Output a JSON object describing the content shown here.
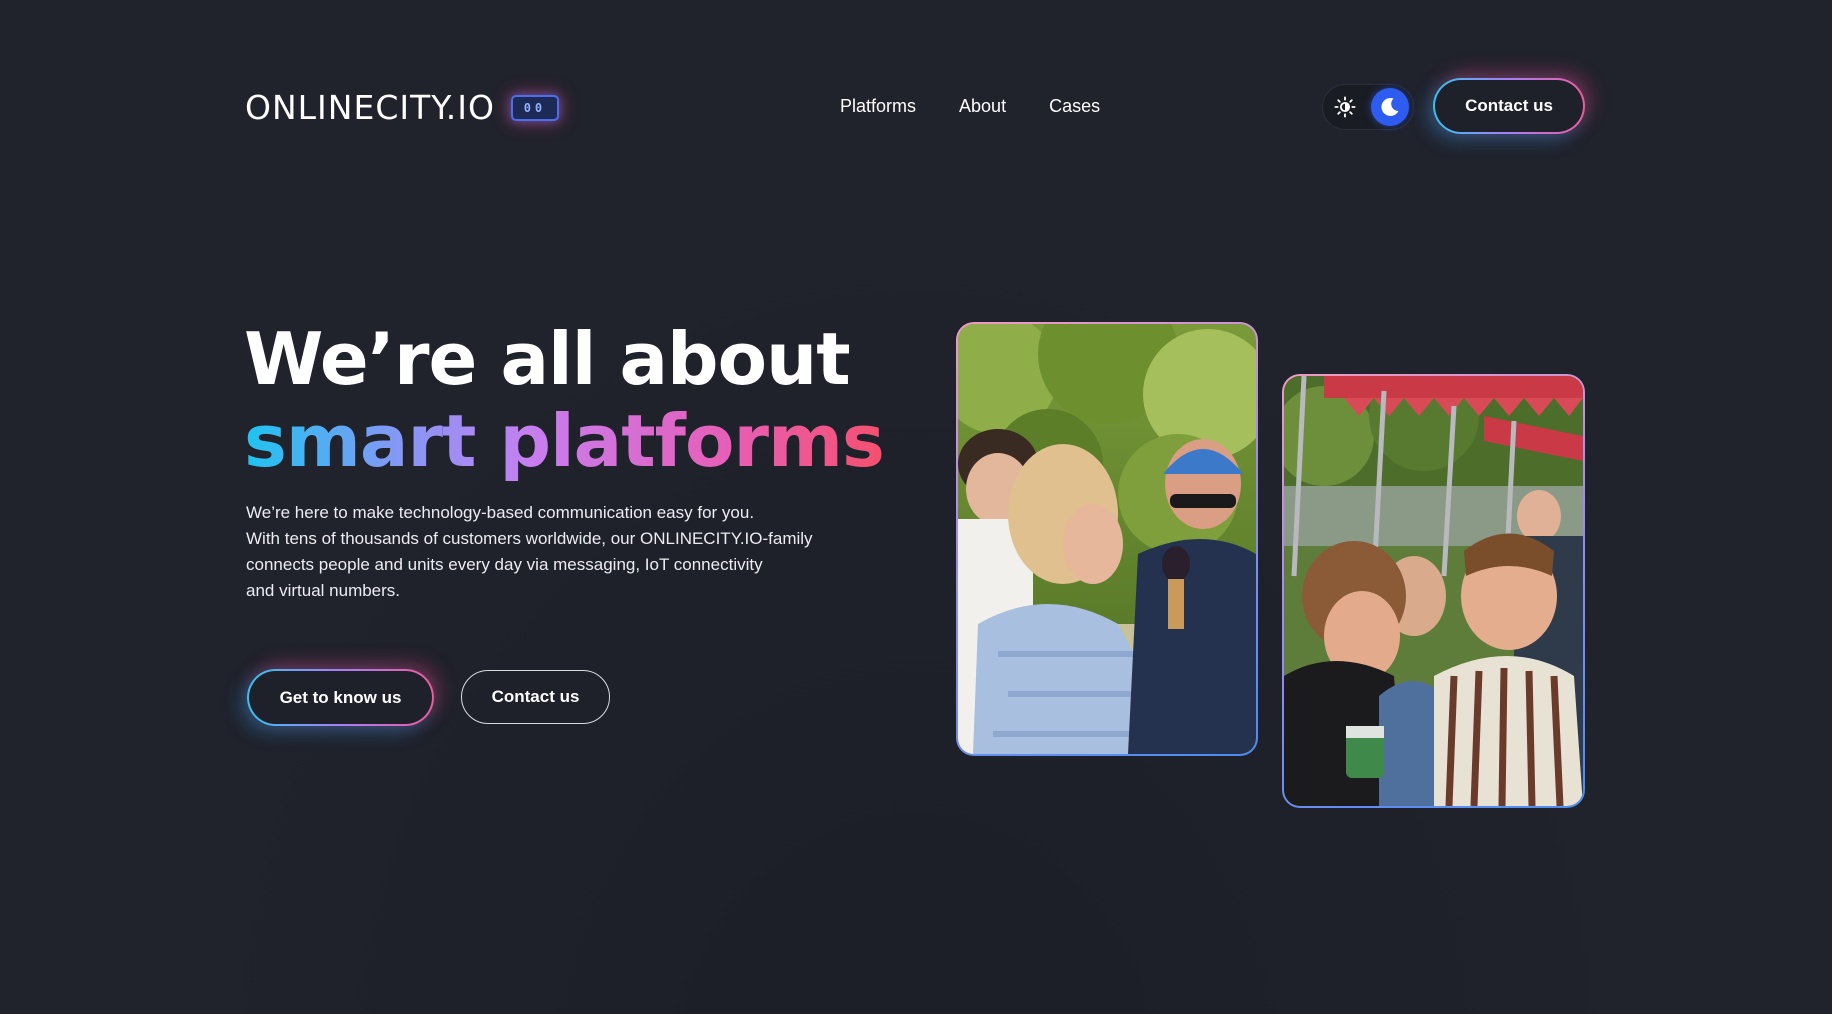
{
  "header": {
    "logo_text": "ONLINECITY.IO",
    "logo_chip": "00",
    "nav": [
      {
        "label": "Platforms"
      },
      {
        "label": "About"
      },
      {
        "label": "Cases"
      }
    ],
    "theme_toggle": {
      "light_icon": "sun-icon",
      "dark_icon": "moon-icon",
      "selected": "dark"
    },
    "contact_label": "Contact us"
  },
  "hero": {
    "title_line1": "We’re all about",
    "title_line2": "smart platforms",
    "description": [
      "We’re here to make technology-based communication easy for you.",
      "With tens of thousands of customers worldwide, our ONLINECITY.IO-family",
      "connects people and units every day via messaging, IoT connectivity",
      "and virtual numbers."
    ],
    "primary_cta": "Get to know us",
    "secondary_cta": "Contact us"
  },
  "colors": {
    "background": "#20222c",
    "accent_blue": "#2f5cf0",
    "gradient_start": "#1ec4f0",
    "gradient_mid": "#c77ef0",
    "gradient_end": "#f5506e"
  }
}
